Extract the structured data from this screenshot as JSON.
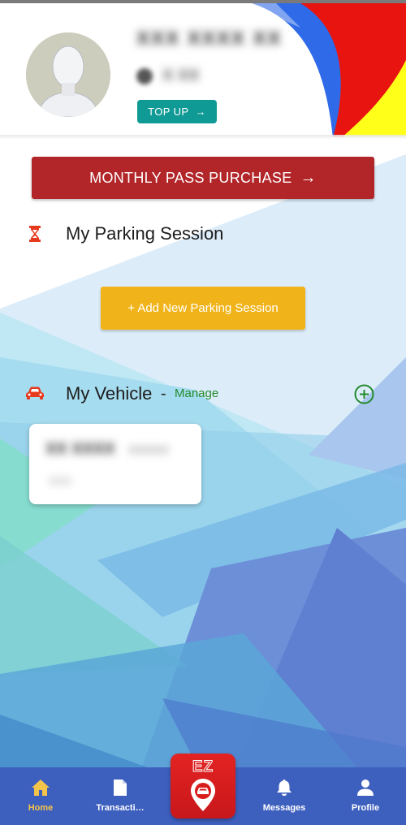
{
  "header": {
    "user_name": "XXX XXXX XX",
    "balance": "X XX",
    "topup_label": "TOP UP"
  },
  "monthly_pass": {
    "label": "MONTHLY PASS PURCHASE"
  },
  "parking_session": {
    "title": "My Parking Session",
    "add_label": "+ Add New Parking Session"
  },
  "vehicle": {
    "title": "My Vehicle",
    "separator": "-",
    "manage_label": "Manage",
    "card": {
      "plate": "XX XXXX",
      "model": "XXXXX",
      "sub": "XXX"
    }
  },
  "nav": {
    "items": [
      {
        "label": "Home",
        "icon": "home-icon",
        "active": true
      },
      {
        "label": "Transacti…",
        "icon": "document-icon",
        "active": false
      },
      {
        "label": "Messages",
        "icon": "bell-icon",
        "active": false
      },
      {
        "label": "Profile",
        "icon": "person-icon",
        "active": false
      }
    ],
    "center_logo_text": "EZ"
  },
  "colors": {
    "topup": "#0f9a95",
    "monthly_pass": "#b2262a",
    "add_session": "#f0b41a",
    "manage": "#238a2c",
    "nav_bg": "#3d5fbe",
    "nav_active": "#f5c44a"
  }
}
